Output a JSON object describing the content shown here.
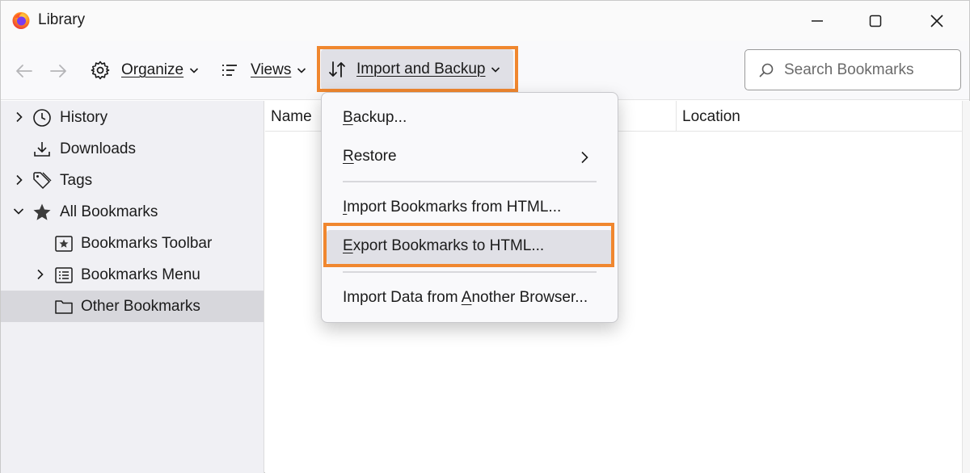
{
  "window": {
    "title": "Library"
  },
  "toolbar": {
    "organize_label": "Organize",
    "views_label": "Views",
    "import_backup_label": "Import and Backup",
    "search_placeholder": "Search Bookmarks"
  },
  "sidebar": {
    "items": [
      {
        "label": "History",
        "icon": "clock-icon"
      },
      {
        "label": "Downloads",
        "icon": "download-icon"
      },
      {
        "label": "Tags",
        "icon": "tags-icon"
      },
      {
        "label": "All Bookmarks",
        "icon": "star-icon"
      },
      {
        "label": "Bookmarks Toolbar",
        "icon": "bookmarks-toolbar-icon"
      },
      {
        "label": "Bookmarks Menu",
        "icon": "bookmarks-menu-icon"
      },
      {
        "label": "Other Bookmarks",
        "icon": "folder-icon"
      }
    ]
  },
  "columns": {
    "name": "Name",
    "location": "Location"
  },
  "menu": {
    "backup": {
      "pre": "",
      "key": "B",
      "post": "ackup..."
    },
    "restore": {
      "pre": "",
      "key": "R",
      "post": "estore"
    },
    "import_html": {
      "pre": "",
      "key": "I",
      "post": "mport Bookmarks from HTML..."
    },
    "export_html": {
      "pre": "",
      "key": "E",
      "post": "xport Bookmarks to HTML..."
    },
    "import_browser": {
      "pre": "Import Data from ",
      "key": "A",
      "post": "nother Browser..."
    }
  },
  "colors": {
    "highlight": "#f0872f",
    "selected_row": "#d7d7dc"
  }
}
